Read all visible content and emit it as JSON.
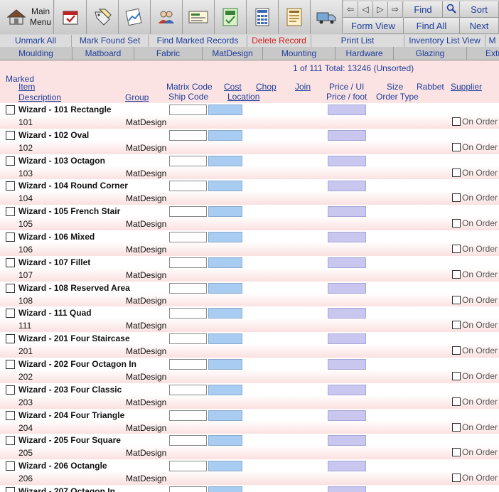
{
  "toolbar": {
    "main_menu_line1": "Main",
    "main_menu_line2": "Menu",
    "nav": [
      "⇦",
      "◁",
      "▷",
      "⇨"
    ],
    "find_label": "Find",
    "sort_label": "Sort",
    "form_view_label": "Form View",
    "find_all_label": "Find All",
    "next_label": "Next"
  },
  "actions": [
    {
      "label": "Unmark All",
      "color": "blue"
    },
    {
      "label": "Mark Found Set",
      "color": "blue"
    },
    {
      "label": "Find Marked Records",
      "color": "blue"
    },
    {
      "label": "Delete Record",
      "color": "red"
    },
    {
      "label": "Print List",
      "color": "blue"
    },
    {
      "label": "Inventory List View",
      "color": "blue"
    },
    {
      "label": "M",
      "color": "blue"
    }
  ],
  "categories": [
    "Moulding",
    "Matboard",
    "Fabric",
    "MatDesign",
    "Mounting",
    "Hardware",
    "Glazing",
    "Extr"
  ],
  "status": {
    "record_position": "1 of 111",
    "total": "Total: 13246",
    "sort_state": "(Unsorted)"
  },
  "headers": {
    "marked": "Marked",
    "item": "Item",
    "description": "Description",
    "group": "Group",
    "matrix_code": "Matrix Code",
    "ship_code": "Ship Code",
    "cost": "Cost",
    "location": "Location",
    "chop": "Chop",
    "join": "Join",
    "price_ui": "Price / UI",
    "price_foot": "Price / foot",
    "size": "Size",
    "order_type": "Order Type",
    "rabbet": "Rabbet",
    "supplier": "Supplier"
  },
  "on_order_label": "On Order",
  "rows": [
    {
      "description": "Wizard - 101 Rectangle",
      "item": "101",
      "group": "MatDesign"
    },
    {
      "description": "Wizard - 102 Oval",
      "item": "102",
      "group": "MatDesign"
    },
    {
      "description": "Wizard - 103 Octagon",
      "item": "103",
      "group": "MatDesign"
    },
    {
      "description": "Wizard - 104 Round Corner",
      "item": "104",
      "group": "MatDesign"
    },
    {
      "description": "Wizard - 105 French Stair",
      "item": "105",
      "group": "MatDesign"
    },
    {
      "description": "Wizard - 106 Mixed",
      "item": "106",
      "group": "MatDesign"
    },
    {
      "description": "Wizard - 107 Fillet",
      "item": "107",
      "group": "MatDesign"
    },
    {
      "description": "Wizard - 108 Reserved Area",
      "item": "108",
      "group": "MatDesign"
    },
    {
      "description": "Wizard - 111 Quad",
      "item": "111",
      "group": "MatDesign"
    },
    {
      "description": "Wizard - 201 Four Staircase",
      "item": "201",
      "group": "MatDesign"
    },
    {
      "description": "Wizard - 202 Four Octagon In",
      "item": "202",
      "group": "MatDesign"
    },
    {
      "description": "Wizard - 203 Four Classic",
      "item": "203",
      "group": "MatDesign"
    },
    {
      "description": "Wizard - 204 Four Triangle",
      "item": "204",
      "group": "MatDesign"
    },
    {
      "description": "Wizard - 205 Four Square",
      "item": "205",
      "group": "MatDesign"
    },
    {
      "description": "Wizard - 206 Octangle",
      "item": "206",
      "group": "MatDesign"
    },
    {
      "description": "Wizard - 207 Octagon In",
      "item": "",
      "group": ""
    }
  ]
}
